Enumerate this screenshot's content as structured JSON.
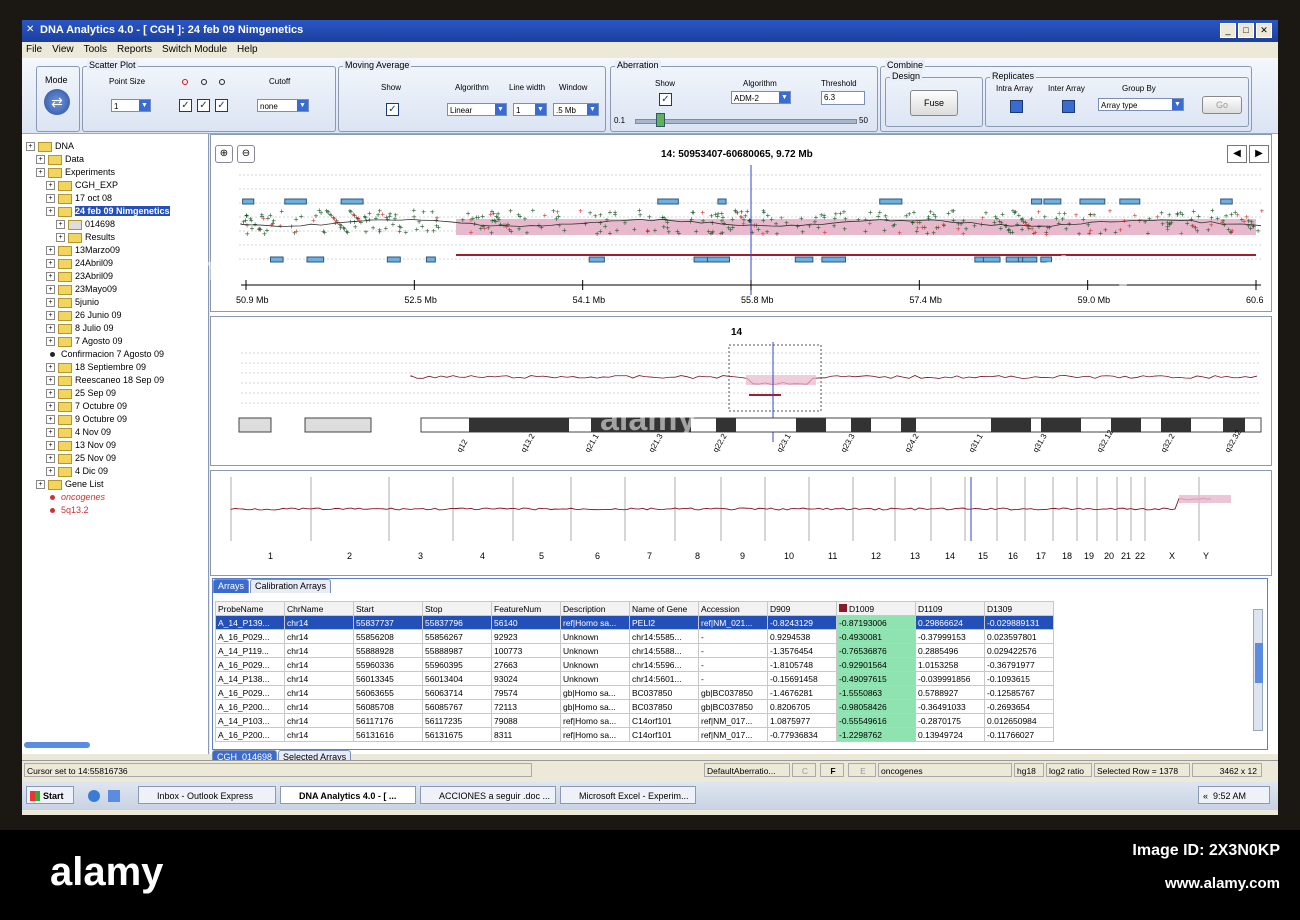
{
  "window": {
    "title": "DNA Analytics 4.0 - [ CGH ]: 24 feb 09 Nimgenetics"
  },
  "menu": [
    "File",
    "View",
    "Tools",
    "Reports",
    "Switch Module",
    "Help"
  ],
  "toolbar": {
    "mode_label": "Mode",
    "scatter": {
      "group": "Scatter Plot",
      "point_size_label": "Point Size",
      "point_size": "1",
      "cutoff_label": "Cutoff",
      "cutoff": "none"
    },
    "moving_average": {
      "group": "Moving Average",
      "show_label": "Show",
      "algorithm_label": "Algorithm",
      "algorithm": "Linear",
      "line_width_label": "Line width",
      "line_width": "1",
      "window_label": "Window",
      "window": ".5 Mb"
    },
    "aberration": {
      "group": "Aberration",
      "show_label": "Show",
      "algorithm_label": "Algorithm",
      "algorithm": "ADM-2",
      "threshold_label": "Threshold",
      "threshold": "6.3",
      "slider_min": "0.1",
      "slider_max": "50"
    },
    "combine": {
      "group": "Combine",
      "design_label": "Design",
      "fuse": "Fuse",
      "replicates_label": "Replicates",
      "intra_label": "Intra Array",
      "inter_label": "Inter Array",
      "group_by_label": "Group By",
      "group_by": "Array type",
      "go": "Go"
    }
  },
  "tree": [
    {
      "label": "DNA",
      "type": "folder",
      "level": 0
    },
    {
      "label": "Data",
      "type": "folder",
      "level": 1
    },
    {
      "label": "Experiments",
      "type": "folder",
      "level": 1
    },
    {
      "label": "CGH_EXP",
      "type": "folder",
      "level": 2
    },
    {
      "label": "17 oct 08",
      "type": "folder",
      "level": 2
    },
    {
      "label": "24 feb 09 Nimgenetics",
      "type": "folder",
      "level": 2,
      "selected": true
    },
    {
      "label": "014698",
      "type": "array",
      "level": 3
    },
    {
      "label": "Results",
      "type": "folder",
      "level": 3
    },
    {
      "label": "13Marzo09",
      "type": "folder",
      "level": 2
    },
    {
      "label": "24Abril09",
      "type": "folder",
      "level": 2
    },
    {
      "label": "23Abril09",
      "type": "folder",
      "level": 2
    },
    {
      "label": "23Mayo09",
      "type": "folder",
      "level": 2
    },
    {
      "label": "5junio",
      "type": "folder",
      "level": 2
    },
    {
      "label": "26 Junio 09",
      "type": "folder",
      "level": 2
    },
    {
      "label": "8 Julio 09",
      "type": "folder",
      "level": 2
    },
    {
      "label": "7 Agosto 09",
      "type": "folder",
      "level": 2
    },
    {
      "label": "Confirmacion 7 Agosto 09",
      "type": "bullet",
      "level": 2
    },
    {
      "label": "18 Septiembre 09",
      "type": "folder",
      "level": 2
    },
    {
      "label": "Reescaneo 18 Sep 09",
      "type": "folder",
      "level": 2
    },
    {
      "label": "25 Sep 09",
      "type": "folder",
      "level": 2
    },
    {
      "label": "7 Octubre 09",
      "type": "folder",
      "level": 2
    },
    {
      "label": "9 Octubre 09",
      "type": "folder",
      "level": 2
    },
    {
      "label": "4 Nov 09",
      "type": "folder",
      "level": 2
    },
    {
      "label": "13 Nov 09",
      "type": "folder",
      "level": 2
    },
    {
      "label": "25 Nov 09",
      "type": "folder",
      "level": 2
    },
    {
      "label": "4 Dic 09",
      "type": "folder",
      "level": 2
    },
    {
      "label": "Gene List",
      "type": "folder",
      "level": 1
    },
    {
      "label": "oncogenes",
      "type": "bullet-red",
      "level": 2
    },
    {
      "label": "5q13.2",
      "type": "bullet-red",
      "level": 2
    }
  ],
  "gene_view": {
    "title": "14: 50953407-60680065, 9.72 Mb",
    "axis_ticks": [
      "50.9 Mb",
      "52.5 Mb",
      "54.1 Mb",
      "55.8 Mb",
      "57.4 Mb",
      "59.0 Mb",
      "60.6"
    ]
  },
  "chrom_view": {
    "title": "14",
    "bands": [
      "q12",
      "q13.2",
      "q21.1",
      "q21.3",
      "q22.2",
      "q23.1",
      "q23.3",
      "q24.2",
      "q31.1",
      "q31.3",
      "q32.12",
      "q32.2",
      "q32.32"
    ]
  },
  "genome_view": {
    "chromosomes": [
      "1",
      "2",
      "3",
      "4",
      "5",
      "6",
      "7",
      "8",
      "9",
      "10",
      "11",
      "12",
      "13",
      "14",
      "15",
      "16",
      "17",
      "18",
      "19",
      "20",
      "21",
      "22",
      "X",
      "Y"
    ]
  },
  "table": {
    "tabs": [
      "Arrays",
      "Calibration Arrays"
    ],
    "bottom_tabs": [
      "CGH_014698",
      "Selected Arrays"
    ],
    "columns": [
      "ProbeName",
      "ChrName",
      "Start",
      "Stop",
      "FeatureNum",
      "Description",
      "Name of Gene",
      "Accession",
      "D909",
      "D1009",
      "D1109",
      "D1309"
    ],
    "rows": [
      [
        "A_14_P139...",
        "chr14",
        "55837737",
        "55837796",
        "56140",
        "ref|Homo sa...",
        "PELI2",
        "ref|NM_021...",
        "-0.8243129",
        "-0.87193006",
        "0.29866624",
        "-0.029889131"
      ],
      [
        "A_16_P029...",
        "chr14",
        "55856208",
        "55856267",
        "92923",
        "Unknown",
        "chr14:5585...",
        "-",
        "0.9294538",
        "-0.4930081",
        "-0.37999153",
        "0.023597801"
      ],
      [
        "A_14_P119...",
        "chr14",
        "55888928",
        "55888987",
        "100773",
        "Unknown",
        "chr14:5588...",
        "-",
        "-1.3576454",
        "-0.76536876",
        "0.2885496",
        "0.029422576"
      ],
      [
        "A_16_P029...",
        "chr14",
        "55960336",
        "55960395",
        "27663",
        "Unknown",
        "chr14:5596...",
        "-",
        "-1.8105748",
        "-0.92901564",
        "1.0153258",
        "-0.36791977"
      ],
      [
        "A_14_P138...",
        "chr14",
        "56013345",
        "56013404",
        "93024",
        "Unknown",
        "chr14:5601...",
        "-",
        "-0.15691458",
        "-0.49097615",
        "-0.039991856",
        "-0.1093615"
      ],
      [
        "A_16_P029...",
        "chr14",
        "56063655",
        "56063714",
        "79574",
        "gb|Homo sa...",
        "BC037850",
        "gb|BC037850",
        "-1.4676281",
        "-1.5550863",
        "0.5788927",
        "-0.12585767"
      ],
      [
        "A_16_P200...",
        "chr14",
        "56085708",
        "56085767",
        "72113",
        "gb|Homo sa...",
        "BC037850",
        "gb|BC037850",
        "0.8206705",
        "-0.98058426",
        "-0.36491033",
        "-0.2693654"
      ],
      [
        "A_14_P103...",
        "chr14",
        "56117176",
        "56117235",
        "79088",
        "ref|Homo sa...",
        "C14orf101",
        "ref|NM_017...",
        "1.0875977",
        "-0.55549616",
        "-0.2870175",
        "0.012650984"
      ],
      [
        "A_16_P200...",
        "chr14",
        "56131616",
        "56131675",
        "8311",
        "ref|Homo sa...",
        "C14orf101",
        "ref|NM_017...",
        "-0.77936834",
        "-1.2298762",
        "0.13949724",
        "-0.11766027"
      ]
    ]
  },
  "status": {
    "cursor": "Cursor set to 14:55816736",
    "aberration": "DefaultAberratio...",
    "c": "C",
    "f": "F",
    "e": "E",
    "genelist": "oncogenes",
    "genome": "hg18",
    "ratio": "log2 ratio",
    "selected": "Selected Row = 1378",
    "dims": "3462 x 12"
  },
  "taskbar": {
    "start": "Start",
    "items": [
      "Inbox - Outlook Express",
      "DNA Analytics 4.0 - [ ...",
      "ACCIONES a seguir .doc ...",
      "Microsoft Excel - Experim..."
    ],
    "clock": "9:52 AM"
  },
  "colors": {
    "title": "#1b3f9e",
    "aberration": "#e8b8cc",
    "selected_row": "#2350b8",
    "highlight_col": "#8fe3b0"
  }
}
